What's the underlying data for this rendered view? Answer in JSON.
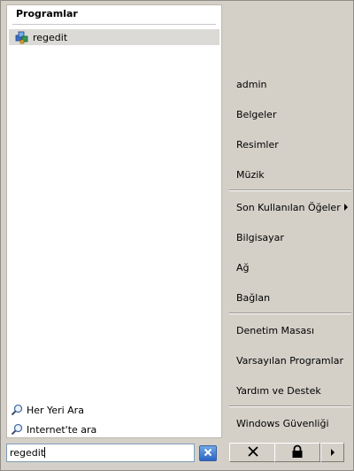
{
  "programs": {
    "header": "Programlar",
    "items": [
      {
        "label": "regedit",
        "icon": "regedit-icon"
      }
    ]
  },
  "search_links": [
    {
      "label": "Her Yeri Ara",
      "icon": "magnifier-icon"
    },
    {
      "label": "Internet'te ara",
      "icon": "magnifier-icon"
    }
  ],
  "right_menu": {
    "items": [
      {
        "label": "admin"
      },
      {
        "label": "Belgeler"
      },
      {
        "label": "Resimler"
      },
      {
        "label": "Müzik"
      },
      {
        "label": "Son Kullanılan Öğeler",
        "has_submenu": true
      },
      {
        "label": "Bilgisayar"
      },
      {
        "label": "Ağ"
      },
      {
        "label": "Bağlan"
      },
      {
        "label": "Denetim Masası"
      },
      {
        "label": "Varsayılan Programlar"
      },
      {
        "label": "Yardım ve Destek"
      },
      {
        "label": "Windows Güvenliği"
      }
    ]
  },
  "search": {
    "value": "regedit",
    "clear_icon": "close-icon"
  },
  "buttons": {
    "power_icon": "close-x-icon",
    "lock_icon": "lock-icon",
    "arrow_icon": "arrow-right-icon"
  },
  "colors": {
    "background": "#d4d0c8",
    "highlight": "#dcdad6",
    "search_clear": "#2b64c5"
  }
}
